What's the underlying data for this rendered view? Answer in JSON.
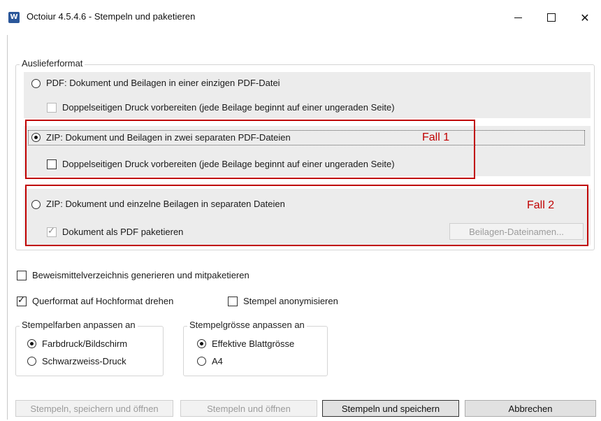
{
  "window": {
    "title": "Octoiur 4.5.4.6 - Stempeln und paketieren",
    "app_icon": "word-icon",
    "app_icon_letter": "W",
    "controls": {
      "minimize": "minimize-icon",
      "maximize": "maximize-icon",
      "close": "close-icon",
      "close_glyph": "✕"
    }
  },
  "delivery": {
    "legend": "Auslieferformat",
    "options": [
      {
        "label": "PDF: Dokument und Beilagen in einer einzigen PDF-Datei",
        "selected": false,
        "sub_check": {
          "label": "Doppelseitigen Druck vorbereiten (jede Beilage beginnt auf einer ungeraden Seite)",
          "checked": false,
          "enabled": false
        }
      },
      {
        "label": "ZIP: Dokument und Beilagen in zwei separaten PDF-Dateien",
        "selected": true,
        "annotation": "Fall 1",
        "sub_check": {
          "label": "Doppelseitigen Druck vorbereiten (jede Beilage beginnt auf einer ungeraden Seite)",
          "checked": false,
          "enabled": true
        }
      },
      {
        "label": "ZIP: Dokument und einzelne Beilagen in separaten Dateien",
        "selected": false,
        "annotation": "Fall 2",
        "sub_check": {
          "label": "Dokument als PDF paketieren",
          "checked": true,
          "enabled": false
        },
        "button": {
          "label": "Beilagen-Dateinamen...",
          "enabled": false
        }
      }
    ]
  },
  "options": {
    "evidence": {
      "label": "Beweismittelverzeichnis generieren und mitpaketieren",
      "checked": false
    },
    "landscape": {
      "label": "Querformat auf Hochformat drehen",
      "checked": true
    },
    "anonymize": {
      "label": "Stempel anonymisieren",
      "checked": false
    }
  },
  "stamp_colors": {
    "legend": "Stempelfarben anpassen an",
    "options": [
      {
        "label": "Farbdruck/Bildschirm",
        "selected": true
      },
      {
        "label": "Schwarzweiss-Druck",
        "selected": false
      }
    ]
  },
  "stamp_size": {
    "legend": "Stempelgrösse anpassen an",
    "options": [
      {
        "label": "Effektive Blattgrösse",
        "selected": true
      },
      {
        "label": "A4",
        "selected": false
      }
    ]
  },
  "buttons": {
    "stamp_save_open": {
      "label": "Stempeln, speichern und öffnen",
      "enabled": false
    },
    "stamp_open": {
      "label": "Stempeln und öffnen",
      "enabled": false
    },
    "stamp_save": {
      "label": "Stempeln und speichern",
      "enabled": true
    },
    "cancel": {
      "label": "Abbrechen",
      "enabled": true
    }
  },
  "colors": {
    "annotation": "#c00000",
    "accent": "#2b579a"
  }
}
